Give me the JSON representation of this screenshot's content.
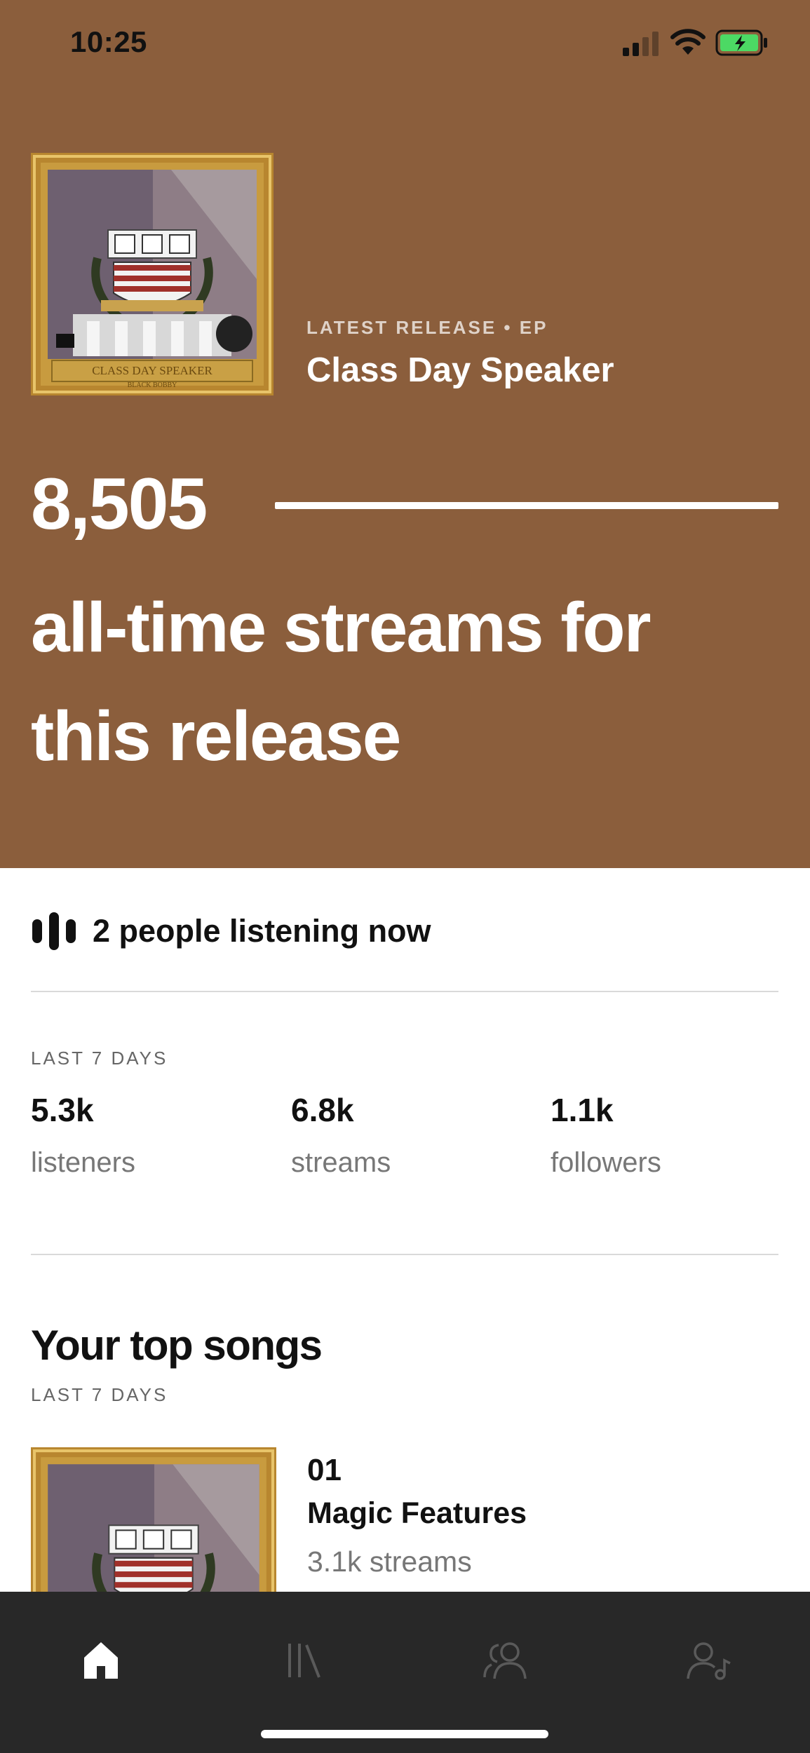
{
  "status_bar": {
    "time": "10:25"
  },
  "release": {
    "kicker": "LATEST RELEASE • EP",
    "title": "Class Day Speaker",
    "cover_text": "CLASS DAY SPEAKER",
    "cover_subtext": "BLACK BOBBY"
  },
  "streams": {
    "count": "8,505",
    "caption": "all-time streams for this release"
  },
  "listening_now": "2 people listening now",
  "last_7_days": {
    "label": "LAST 7 DAYS",
    "stats": [
      {
        "value": "5.3k",
        "label": "listeners"
      },
      {
        "value": "6.8k",
        "label": "streams"
      },
      {
        "value": "1.1k",
        "label": "followers"
      }
    ]
  },
  "top_songs": {
    "title": "Your top songs",
    "period": "LAST 7 DAYS",
    "items": [
      {
        "rank": "01",
        "title": "Magic Features",
        "streams": "3.1k streams"
      }
    ]
  },
  "tab_bar": {
    "tabs": [
      {
        "icon": "home-icon",
        "active": true
      },
      {
        "icon": "library-icon",
        "active": false
      },
      {
        "icon": "audience-icon",
        "active": false
      },
      {
        "icon": "profile-music-icon",
        "active": false
      }
    ]
  },
  "colors": {
    "hero_background": "#8b5e3c",
    "tab_bar_background": "#282828",
    "battery_charging": "#4cd964"
  }
}
